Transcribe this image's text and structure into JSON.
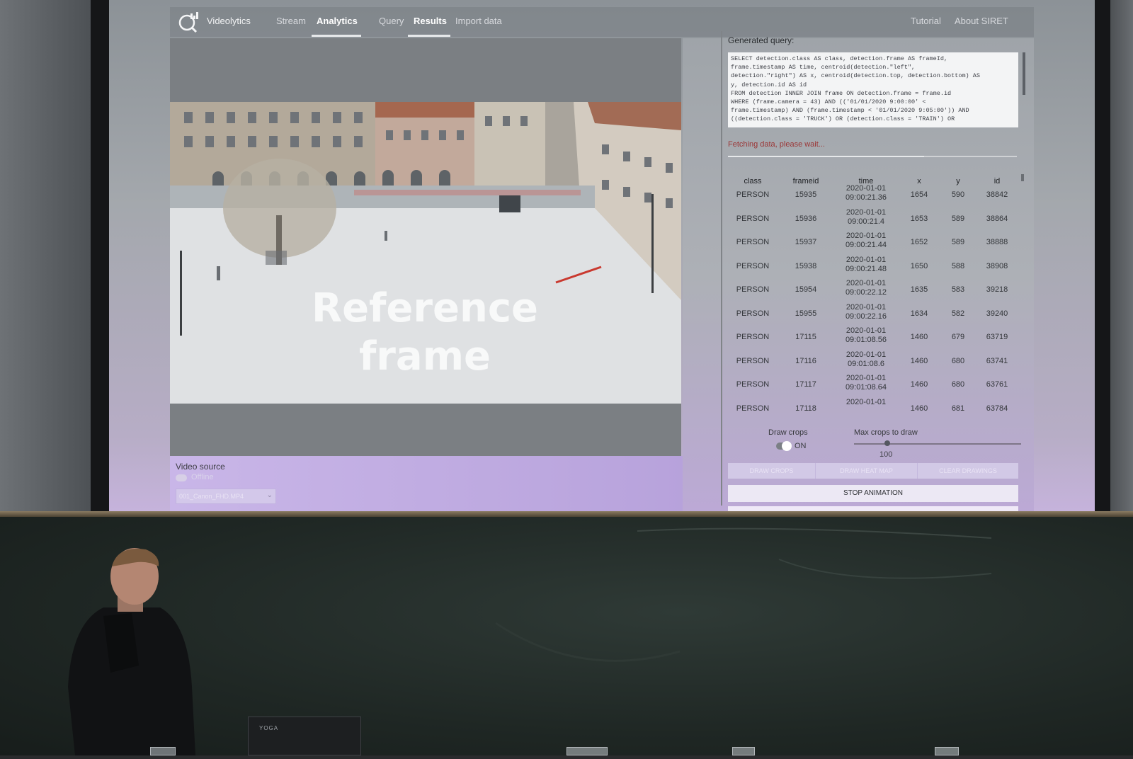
{
  "app": {
    "name": "Videolytics",
    "nav": {
      "stream": "Stream",
      "analytics": "Analytics",
      "query": "Query",
      "results": "Results",
      "import_data": "Import data",
      "tutorial": "Tutorial",
      "about": "About SIRET"
    }
  },
  "frame": {
    "overlay_line1": "Reference",
    "overlay_line2": "frame"
  },
  "video_source": {
    "label": "Video source",
    "toggle_label": "Offline",
    "selected_file": "001_Canon_FHD.MP4"
  },
  "query": {
    "label": "Generated query:",
    "sql": [
      "SELECT detection.class AS class, detection.frame AS frameId,",
      "frame.timestamp AS time, centroid(detection.\"left\",",
      "detection.\"right\") AS x, centroid(detection.top, detection.bottom) AS",
      "y,  detection.id AS id",
      "FROM detection INNER JOIN frame ON detection.frame = frame.id",
      "WHERE (frame.camera = 43) AND (('01/01/2020 9:00:00' <",
      "frame.timestamp) AND (frame.timestamp < '01/01/2020 9:05:00')) AND",
      "((detection.class = 'TRUCK') OR (detection.class = 'TRAIN') OR"
    ],
    "status": "Fetching data, please wait...",
    "progress_fraction": 0.68
  },
  "results": {
    "columns": [
      "class",
      "frameid",
      "time",
      "x",
      "y",
      "id"
    ],
    "rows": [
      {
        "class": "PERSON",
        "frameid": "15935",
        "date": "2020-01-01",
        "clock": "09:00:21.36",
        "x": "1654",
        "y": "590",
        "id": "38842"
      },
      {
        "class": "PERSON",
        "frameid": "15936",
        "date": "2020-01-01",
        "clock": "09:00:21.4",
        "x": "1653",
        "y": "589",
        "id": "38864"
      },
      {
        "class": "PERSON",
        "frameid": "15937",
        "date": "2020-01-01",
        "clock": "09:00:21.44",
        "x": "1652",
        "y": "589",
        "id": "38888"
      },
      {
        "class": "PERSON",
        "frameid": "15938",
        "date": "2020-01-01",
        "clock": "09:00:21.48",
        "x": "1650",
        "y": "588",
        "id": "38908"
      },
      {
        "class": "PERSON",
        "frameid": "15954",
        "date": "2020-01-01",
        "clock": "09:00:22.12",
        "x": "1635",
        "y": "583",
        "id": "39218"
      },
      {
        "class": "PERSON",
        "frameid": "15955",
        "date": "2020-01-01",
        "clock": "09:00:22.16",
        "x": "1634",
        "y": "582",
        "id": "39240"
      },
      {
        "class": "PERSON",
        "frameid": "17115",
        "date": "2020-01-01",
        "clock": "09:01:08.56",
        "x": "1460",
        "y": "679",
        "id": "63719"
      },
      {
        "class": "PERSON",
        "frameid": "17116",
        "date": "2020-01-01",
        "clock": "09:01:08.6",
        "x": "1460",
        "y": "680",
        "id": "63741"
      },
      {
        "class": "PERSON",
        "frameid": "17117",
        "date": "2020-01-01",
        "clock": "09:01:08.64",
        "x": "1460",
        "y": "680",
        "id": "63761"
      },
      {
        "class": "PERSON",
        "frameid": "17118",
        "date": "2020-01-01",
        "clock": "",
        "x": "1460",
        "y": "681",
        "id": "63784"
      }
    ]
  },
  "controls": {
    "draw_crops_label": "Draw crops",
    "draw_crops_state": "ON",
    "max_crops_label": "Max crops to draw",
    "max_crops_value": "100",
    "max_crops_fraction": 0.2,
    "btn_draw_crops": "DRAW CROPS",
    "btn_draw_heat_map": "DRAW HEAT MAP",
    "btn_clear_drawings": "CLEAR DRAWINGS",
    "btn_stop_animation": "STOP ANIMATION"
  },
  "laptop_brand": "YOGA",
  "colors": {
    "status_text": "#9b3636",
    "panel_lavender": "#c9b6e8",
    "chalkboard": "#1f2724"
  }
}
